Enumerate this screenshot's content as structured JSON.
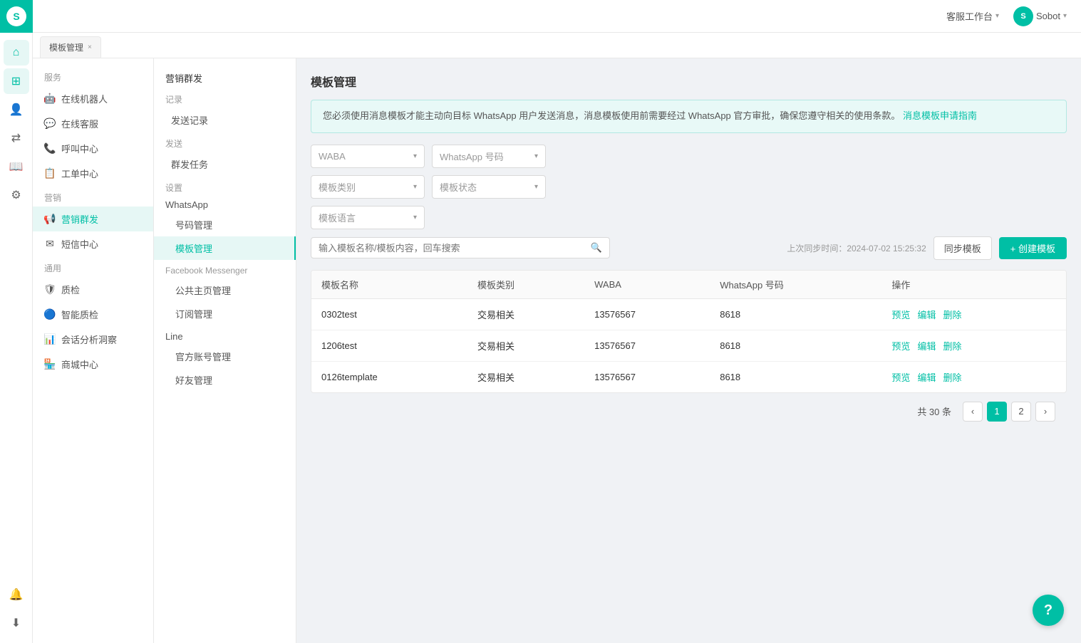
{
  "app": {
    "logo": "S",
    "topbar": {
      "workspace_label": "客服工作台",
      "user_label": "Sobot",
      "chevron": "▾"
    },
    "tab": {
      "label": "模板管理",
      "close": "×"
    }
  },
  "icon_sidebar": {
    "icons": [
      {
        "name": "home-icon",
        "symbol": "⌂"
      },
      {
        "name": "grid-icon",
        "symbol": "⊞"
      },
      {
        "name": "user-icon",
        "symbol": "👤"
      },
      {
        "name": "exchange-icon",
        "symbol": "⇄"
      },
      {
        "name": "book-icon",
        "symbol": "📖"
      },
      {
        "name": "gear-icon",
        "symbol": "⚙"
      },
      {
        "name": "bell-icon",
        "symbol": "🔔"
      },
      {
        "name": "download-icon",
        "symbol": "⬇"
      }
    ]
  },
  "left_nav": {
    "sections": [
      {
        "title": "服务",
        "items": [
          {
            "label": "在线机器人",
            "icon": "🤖",
            "name": "online-robot"
          },
          {
            "label": "在线客服",
            "icon": "💬",
            "name": "online-service"
          },
          {
            "label": "呼叫中心",
            "icon": "📞",
            "name": "call-center"
          },
          {
            "label": "工单中心",
            "icon": "📋",
            "name": "ticket-center"
          }
        ]
      },
      {
        "title": "营销",
        "items": [
          {
            "label": "营销群发",
            "icon": "📢",
            "name": "marketing-broadcast",
            "active": true
          },
          {
            "label": "短信中心",
            "icon": "✉",
            "name": "sms-center"
          }
        ]
      },
      {
        "title": "通用",
        "items": [
          {
            "label": "质检",
            "icon": "🛡",
            "name": "quality-check"
          },
          {
            "label": "智能质检",
            "icon": "🔵",
            "name": "smart-quality-check"
          },
          {
            "label": "会话分析洞察",
            "icon": "📊",
            "name": "conversation-analysis"
          },
          {
            "label": "商城中心",
            "icon": "🏪",
            "name": "mall-center"
          }
        ]
      }
    ]
  },
  "secondary_nav": {
    "groups": [
      {
        "title": "营销群发",
        "items": [
          {
            "group": "记录",
            "items": [
              {
                "label": "发送记录",
                "name": "send-records"
              }
            ]
          },
          {
            "group": "发送",
            "items": [
              {
                "label": "群发任务",
                "name": "broadcast-tasks"
              }
            ]
          },
          {
            "group": "设置",
            "sub_groups": [
              {
                "label": "WhatsApp",
                "items": [
                  {
                    "label": "号码管理",
                    "name": "number-management"
                  },
                  {
                    "label": "模板管理",
                    "name": "template-management",
                    "active": true
                  }
                ]
              },
              {
                "label": "Facebook Messenger",
                "items": [
                  {
                    "label": "公共主页管理",
                    "name": "page-management"
                  },
                  {
                    "label": "订阅管理",
                    "name": "subscription-management"
                  }
                ]
              },
              {
                "label": "Line",
                "items": [
                  {
                    "label": "官方账号管理",
                    "name": "official-account-management"
                  },
                  {
                    "label": "好友管理",
                    "name": "friend-management"
                  }
                ]
              }
            ]
          }
        ]
      }
    ]
  },
  "template_management": {
    "title": "模板管理",
    "info_text": "您必须使用消息模板才能主动向目标 WhatsApp 用户发送消息，消息模板使用前需要经过 WhatsApp 官方审批，确保您遵守相关的使用条款。",
    "info_link_text": "消息模板申请指南",
    "filters": {
      "waba_placeholder": "WABA",
      "whatsapp_number_placeholder": "WhatsApp 号码",
      "template_type_placeholder": "模板类别",
      "template_status_placeholder": "模板状态",
      "template_language_placeholder": "模板语言"
    },
    "search": {
      "placeholder": "输入模板名称/模板内容，回车搜索"
    },
    "sync": {
      "last_sync_label": "上次同步时间：2024-07-02 15:25:32",
      "sync_btn_label": "同步模板",
      "create_btn_label": "+ 创建模板"
    },
    "table": {
      "columns": [
        "模板名称",
        "模板类别",
        "WABA",
        "WhatsApp 号码",
        "操作"
      ],
      "rows": [
        {
          "name": "0302test",
          "type": "交易相关",
          "waba": "13576567",
          "phone": "8618",
          "actions": [
            "预览",
            "编辑",
            "删除"
          ]
        },
        {
          "name": "1206test",
          "type": "交易相关",
          "waba": "13576567",
          "phone": "8618",
          "actions": [
            "预览",
            "编辑",
            "删除"
          ]
        },
        {
          "name": "0126template",
          "type": "交易相关",
          "waba": "13576567",
          "phone": "8618",
          "actions": [
            "预览",
            "编辑",
            "删除"
          ]
        }
      ]
    },
    "pagination": {
      "total_label": "共 30 条",
      "current_page": 1,
      "total_pages": 2,
      "prev_icon": "‹",
      "next_icon": "›"
    }
  },
  "help_btn_label": "?"
}
